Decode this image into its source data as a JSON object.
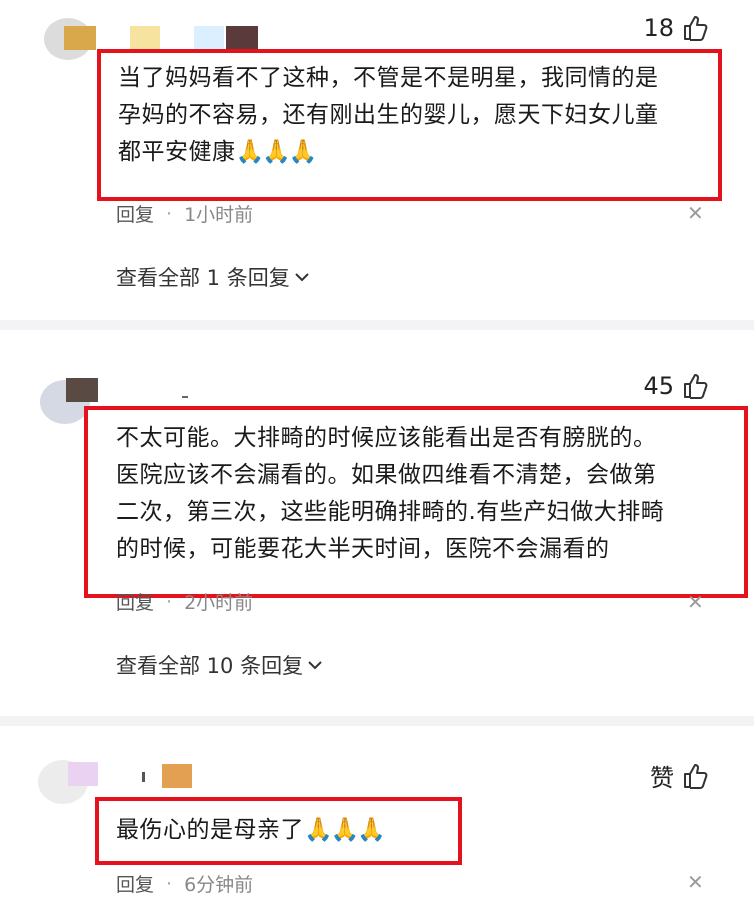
{
  "comments": [
    {
      "likes": "18",
      "text_lines": [
        "当了妈妈看不了这种，不管是不是明星，我同情的是",
        "孕妈的不容易，还有刚出生的婴儿，愿天下妇女儿童",
        "都平安健康"
      ],
      "emoji": "🙏🙏🙏",
      "reply_label": "回复",
      "time": "1小时前",
      "view_replies": "查看全部 1 条回复"
    },
    {
      "likes": "45",
      "text_lines": [
        "不太可能。大排畸的时候应该能看出是否有膀胱的。",
        "医院应该不会漏看的。如果做四维看不清楚，会做第",
        "二次，第三次，这些能明确排畸的.有些产妇做大排畸",
        "的时候，可能要花大半天时间，医院不会漏看的"
      ],
      "reply_label": "回复",
      "time": "2小时前",
      "view_replies": "查看全部 10 条回复"
    },
    {
      "likes": "赞",
      "text_lines": [
        "最伤心的是母亲了"
      ],
      "emoji": "🙏🙏🙏",
      "reply_label": "回复",
      "time": "6分钟前"
    }
  ],
  "icons": {
    "like": "thumbs-up-icon",
    "close": "close-icon",
    "chevron": "chevron-down-icon"
  },
  "colors": {
    "highlight_box": "#e3121c",
    "meta_text": "#888888"
  }
}
